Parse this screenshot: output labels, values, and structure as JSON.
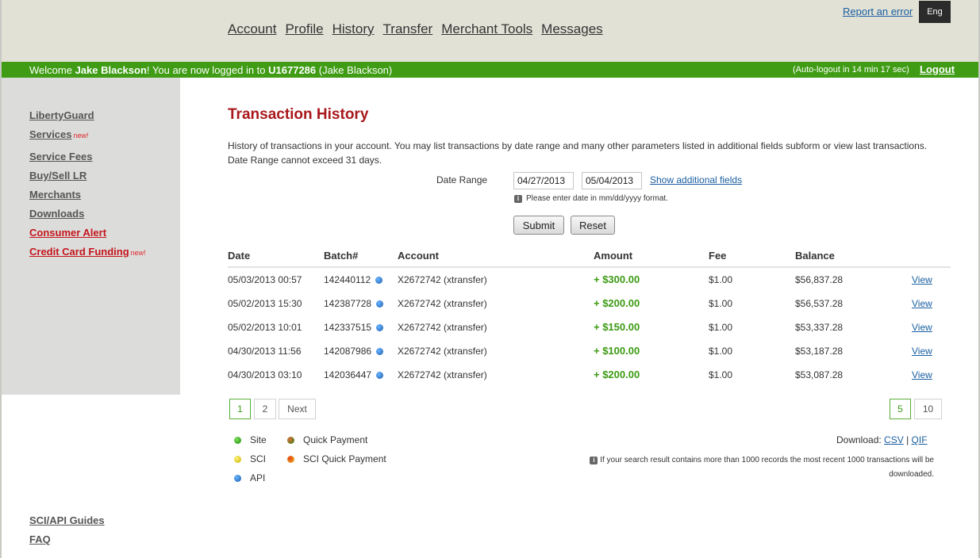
{
  "header": {
    "nav": [
      "Account",
      "Profile",
      "History",
      "Transfer",
      "Merchant Tools",
      "Messages"
    ],
    "report_error": "Report an error",
    "language": "Eng"
  },
  "welcome_bar": {
    "prefix": "Welcome ",
    "user_name": "Jake Blackson",
    "middle": "! You are now logged in to ",
    "account_id": "U1677286",
    "suffix": " (Jake Blackson)",
    "autologout": "(Auto-logout in 14 min 17 sec)",
    "logout": "Logout"
  },
  "sidebar": {
    "items": [
      {
        "label": "LibertyGuard",
        "new": ""
      },
      {
        "label": "Services",
        "new": "new!"
      },
      {
        "label": "Service Fees",
        "new": ""
      },
      {
        "label": "Buy/Sell LR",
        "new": ""
      },
      {
        "label": "Merchants",
        "new": ""
      },
      {
        "label": "Downloads",
        "new": ""
      },
      {
        "label": "Consumer Alert",
        "new": ""
      },
      {
        "label": "Credit Card Funding",
        "new": "new!"
      }
    ],
    "bottom_links": [
      "SCI/API Guides",
      "FAQ"
    ]
  },
  "main": {
    "title": "Transaction History",
    "intro": "History of transactions in your account. You may list transactions by date range and many other parameters listed in additional fields subform or view last transactions. Date Range cannot exceed 31 days.",
    "date_range_label": "Date Range",
    "date_from": "04/27/2013",
    "date_to": "05/04/2013",
    "show_additional": "Show additional fields",
    "date_hint": "Please enter date in mm/dd/yyyy format.",
    "submit": "Submit",
    "reset": "Reset"
  },
  "table": {
    "headers": [
      "Date",
      "Batch#",
      "Account",
      "Amount",
      "Fee",
      "Balance"
    ],
    "rows": [
      {
        "date": "05/03/2013 00:57",
        "batch": "142440112",
        "account": "X2672742 (xtransfer)",
        "amount": "+ $300.00",
        "fee": "$1.00",
        "balance": "$56,837.28",
        "view": "View"
      },
      {
        "date": "05/02/2013 15:30",
        "batch": "142387728",
        "account": "X2672742 (xtransfer)",
        "amount": "+ $200.00",
        "fee": "$1.00",
        "balance": "$56,537.28",
        "view": "View"
      },
      {
        "date": "05/02/2013 10:01",
        "batch": "142337515",
        "account": "X2672742 (xtransfer)",
        "amount": "+ $150.00",
        "fee": "$1.00",
        "balance": "$53,337.28",
        "view": "View"
      },
      {
        "date": "04/30/2013 11:56",
        "batch": "142087986",
        "account": "X2672742 (xtransfer)",
        "amount": "+ $100.00",
        "fee": "$1.00",
        "balance": "$53,187.28",
        "view": "View"
      },
      {
        "date": "04/30/2013 03:10",
        "batch": "142036447",
        "account": "X2672742 (xtransfer)",
        "amount": "+ $200.00",
        "fee": "$1.00",
        "balance": "$53,087.28",
        "view": "View"
      }
    ]
  },
  "pagination": {
    "pages": [
      "1",
      "2"
    ],
    "next": "Next",
    "per_page": [
      "5",
      "10"
    ]
  },
  "legend": {
    "site": "Site",
    "sci": "SCI",
    "api": "API",
    "quick_payment": "Quick Payment",
    "sci_quick_payment": "SCI Quick Payment"
  },
  "download": {
    "label": "Download: ",
    "csv": "CSV",
    "separator": " | ",
    "qif": "QIF",
    "note": "If your search result contains more than 1000 records the most recent 1000 transactions will be downloaded."
  },
  "colors": {
    "accent_green": "#3f9c14",
    "title_red": "#a8181c",
    "link_blue": "#1a5fa0"
  }
}
